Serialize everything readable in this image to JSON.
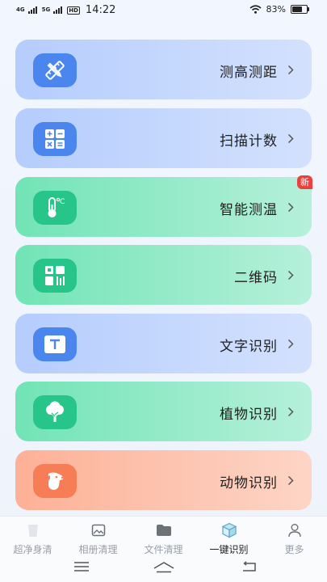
{
  "status_bar": {
    "signal1": "4G",
    "signal2": "5G",
    "hd": "HD",
    "time": "14:22",
    "battery_text": "83%",
    "battery_level": 0.83
  },
  "tools": [
    {
      "label": "测高测距",
      "icon": "ruler-pencil-icon",
      "color": "#4a86ee"
    },
    {
      "label": "扫描计数",
      "icon": "calculator-icon",
      "color": "#4a86ee"
    },
    {
      "label": "智能测温",
      "icon": "thermometer-icon",
      "color": "#28c58b",
      "badge": "新"
    },
    {
      "label": "二维码",
      "icon": "qr-code-icon",
      "color": "#28c58b"
    },
    {
      "label": "文字识别",
      "icon": "text-recognition-icon",
      "color": "#4a86ee"
    },
    {
      "label": "植物识别",
      "icon": "tree-icon",
      "color": "#28c58b"
    },
    {
      "label": "动物识别",
      "icon": "dog-icon",
      "color": "#f77d56"
    }
  ],
  "tabs": [
    {
      "label": "超净身清",
      "icon": "cup-icon"
    },
    {
      "label": "相册清理",
      "icon": "photo-icon"
    },
    {
      "label": "文件清理",
      "icon": "folder-icon"
    },
    {
      "label": "一键识别",
      "icon": "cube-icon",
      "active": true
    },
    {
      "label": "更多",
      "icon": "user-icon"
    }
  ]
}
